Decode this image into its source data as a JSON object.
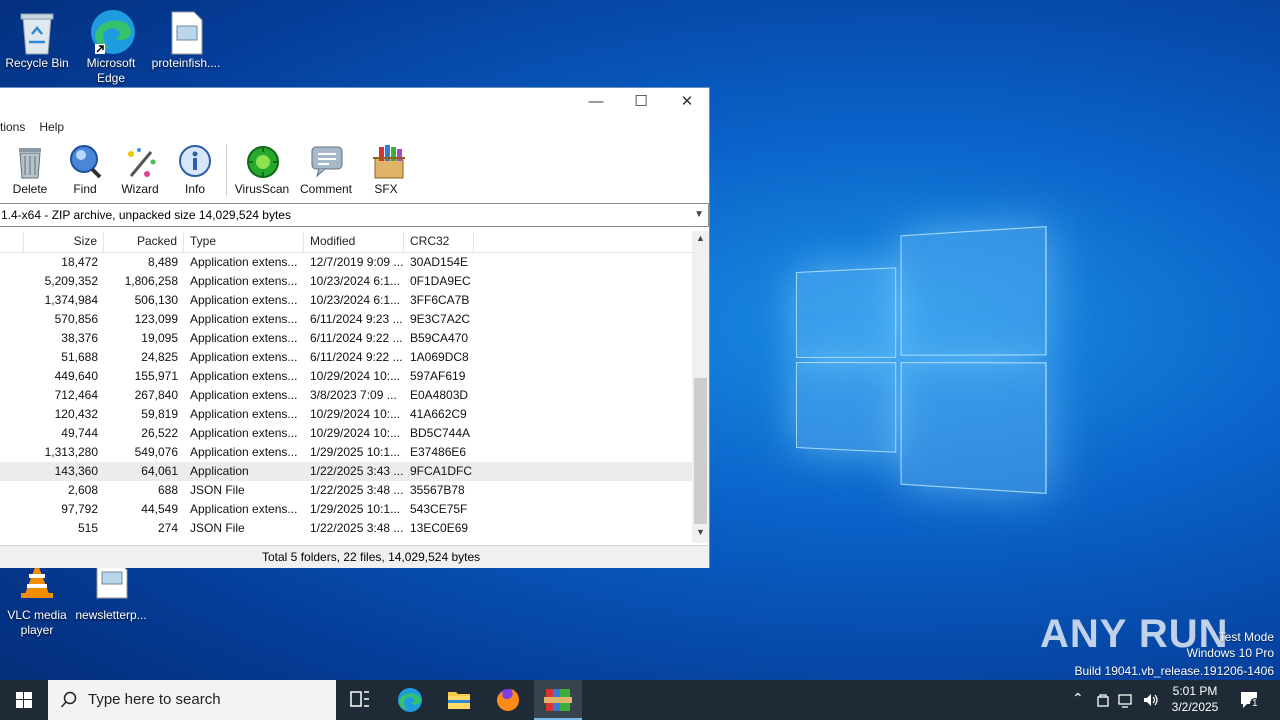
{
  "desktop": {
    "icons": [
      {
        "label": "Recycle Bin"
      },
      {
        "label": "Microsoft Edge"
      },
      {
        "label": "proteinfish...."
      },
      {
        "label": "VLC media player"
      },
      {
        "label": "newsletterp..."
      }
    ],
    "watermark": {
      "brand": "ANY RUN",
      "line1": "Test Mode",
      "line2": "Windows 10 Pro",
      "line3": "Build 19041.vb_release.191206-1406"
    }
  },
  "window": {
    "menu": [
      {
        "label": "tions"
      },
      {
        "label": "Help"
      }
    ],
    "toolbar": [
      {
        "label": "Delete",
        "icon": "delete-icon"
      },
      {
        "label": "Find",
        "icon": "find-icon"
      },
      {
        "label": "Wizard",
        "icon": "wizard-icon"
      },
      {
        "label": "Info",
        "icon": "info-icon"
      },
      {
        "label": "VirusScan",
        "icon": "virusscan-icon"
      },
      {
        "label": "Comment",
        "icon": "comment-icon"
      },
      {
        "label": "SFX",
        "icon": "sfx-icon"
      }
    ],
    "path": "1.4-x64 - ZIP archive, unpacked size 14,029,524 bytes",
    "columns": {
      "size": "Size",
      "packed": "Packed",
      "type": "Type",
      "modified": "Modified",
      "crc": "CRC32"
    },
    "rows": [
      {
        "size": "18,472",
        "packed": "8,489",
        "type": "Application extens...",
        "modified": "12/7/2019 9:09 ...",
        "crc": "30AD154E"
      },
      {
        "size": "5,209,352",
        "packed": "1,806,258",
        "type": "Application extens...",
        "modified": "10/23/2024 6:1...",
        "crc": "0F1DA9EC"
      },
      {
        "size": "1,374,984",
        "packed": "506,130",
        "type": "Application extens...",
        "modified": "10/23/2024 6:1...",
        "crc": "3FF6CA7B"
      },
      {
        "size": "570,856",
        "packed": "123,099",
        "type": "Application extens...",
        "modified": "6/11/2024 9:23 ...",
        "crc": "9E3C7A2C"
      },
      {
        "size": "38,376",
        "packed": "19,095",
        "type": "Application extens...",
        "modified": "6/11/2024 9:22 ...",
        "crc": "B59CA470"
      },
      {
        "size": "51,688",
        "packed": "24,825",
        "type": "Application extens...",
        "modified": "6/11/2024 9:22 ...",
        "crc": "1A069DC8"
      },
      {
        "size": "449,640",
        "packed": "155,971",
        "type": "Application extens...",
        "modified": "10/29/2024 10:...",
        "crc": "597AF619"
      },
      {
        "size": "712,464",
        "packed": "267,840",
        "type": "Application extens...",
        "modified": "3/8/2023 7:09 ...",
        "crc": "E0A4803D"
      },
      {
        "size": "120,432",
        "packed": "59,819",
        "type": "Application extens...",
        "modified": "10/29/2024 10:...",
        "crc": "41A662C9"
      },
      {
        "size": "49,744",
        "packed": "26,522",
        "type": "Application extens...",
        "modified": "10/29/2024 10:...",
        "crc": "BD5C744A"
      },
      {
        "size": "1,313,280",
        "packed": "549,076",
        "type": "Application extens...",
        "modified": "1/29/2025 10:1...",
        "crc": "E37486E6"
      },
      {
        "size": "143,360",
        "packed": "64,061",
        "type": "Application",
        "modified": "1/22/2025 3:43 ...",
        "crc": "9FCA1DFC"
      },
      {
        "size": "2,608",
        "packed": "688",
        "type": "JSON File",
        "modified": "1/22/2025 3:48 ...",
        "crc": "35567B78"
      },
      {
        "size": "97,792",
        "packed": "44,549",
        "type": "Application extens...",
        "modified": "1/29/2025 10:1...",
        "crc": "543CE75F"
      },
      {
        "size": "515",
        "packed": "274",
        "type": "JSON File",
        "modified": "1/22/2025 3:48 ...",
        "crc": "13EC0E69"
      }
    ],
    "status": "Total 5 folders, 22 files, 14,029,524 bytes"
  },
  "taskbar": {
    "search_placeholder": "Type here to search",
    "time": "5:01 PM",
    "date": "3/2/2025",
    "notifications": "1"
  }
}
